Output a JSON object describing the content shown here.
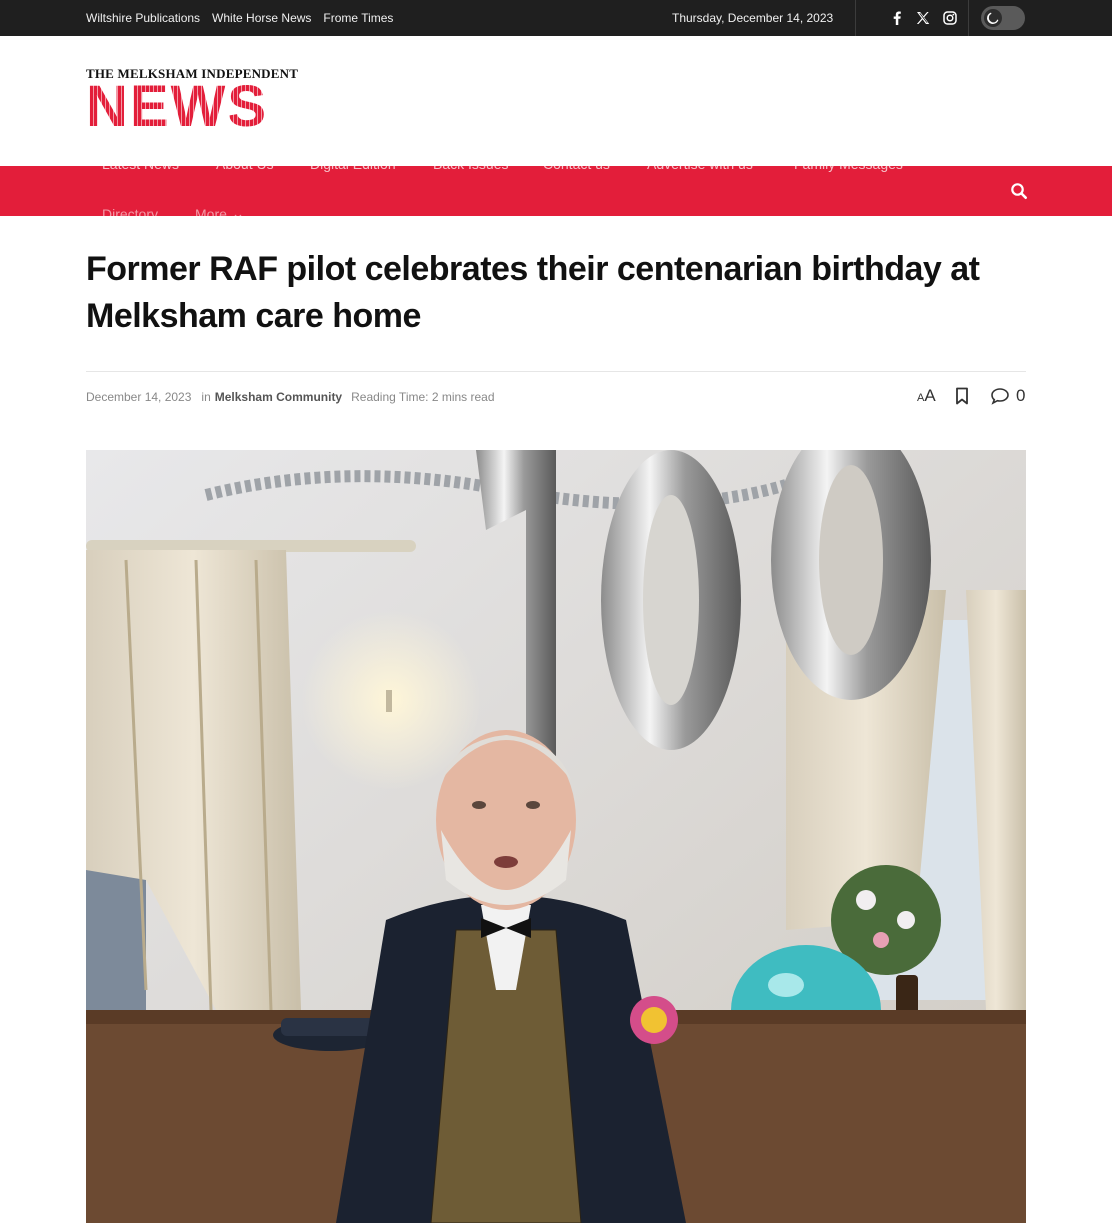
{
  "topbar": {
    "links": [
      "Wiltshire Publications",
      "White Horse News",
      "Frome Times"
    ],
    "date": "Thursday, December 14, 2023",
    "social_icons": [
      "facebook-icon",
      "x-twitter-icon",
      "instagram-icon"
    ],
    "dark_mode_icon": "moon-icon"
  },
  "logo": {
    "top_line": "THE MELKSHAM INDEPENDENT",
    "main": "NEWS"
  },
  "nav": {
    "items": [
      "Latest News",
      "About Us",
      "Digital Edition",
      "Back Issues",
      "Contact us",
      "Advertise with us",
      "Family Messages"
    ],
    "row2": [
      "Directory",
      "More"
    ],
    "search_icon": "search-icon"
  },
  "colors": {
    "brand_red": "#e31e3a",
    "topbar_bg": "#1f1f1f"
  },
  "article": {
    "title": "Former RAF pilot celebrates their centenarian birthday at Melksham care home",
    "date": "December 14, 2023",
    "in_label": "in",
    "category": "Melksham Community",
    "reading_time": "Reading Time: 2 mins read",
    "font_size_small": "A",
    "font_size_large": "A",
    "comment_count": "0"
  }
}
